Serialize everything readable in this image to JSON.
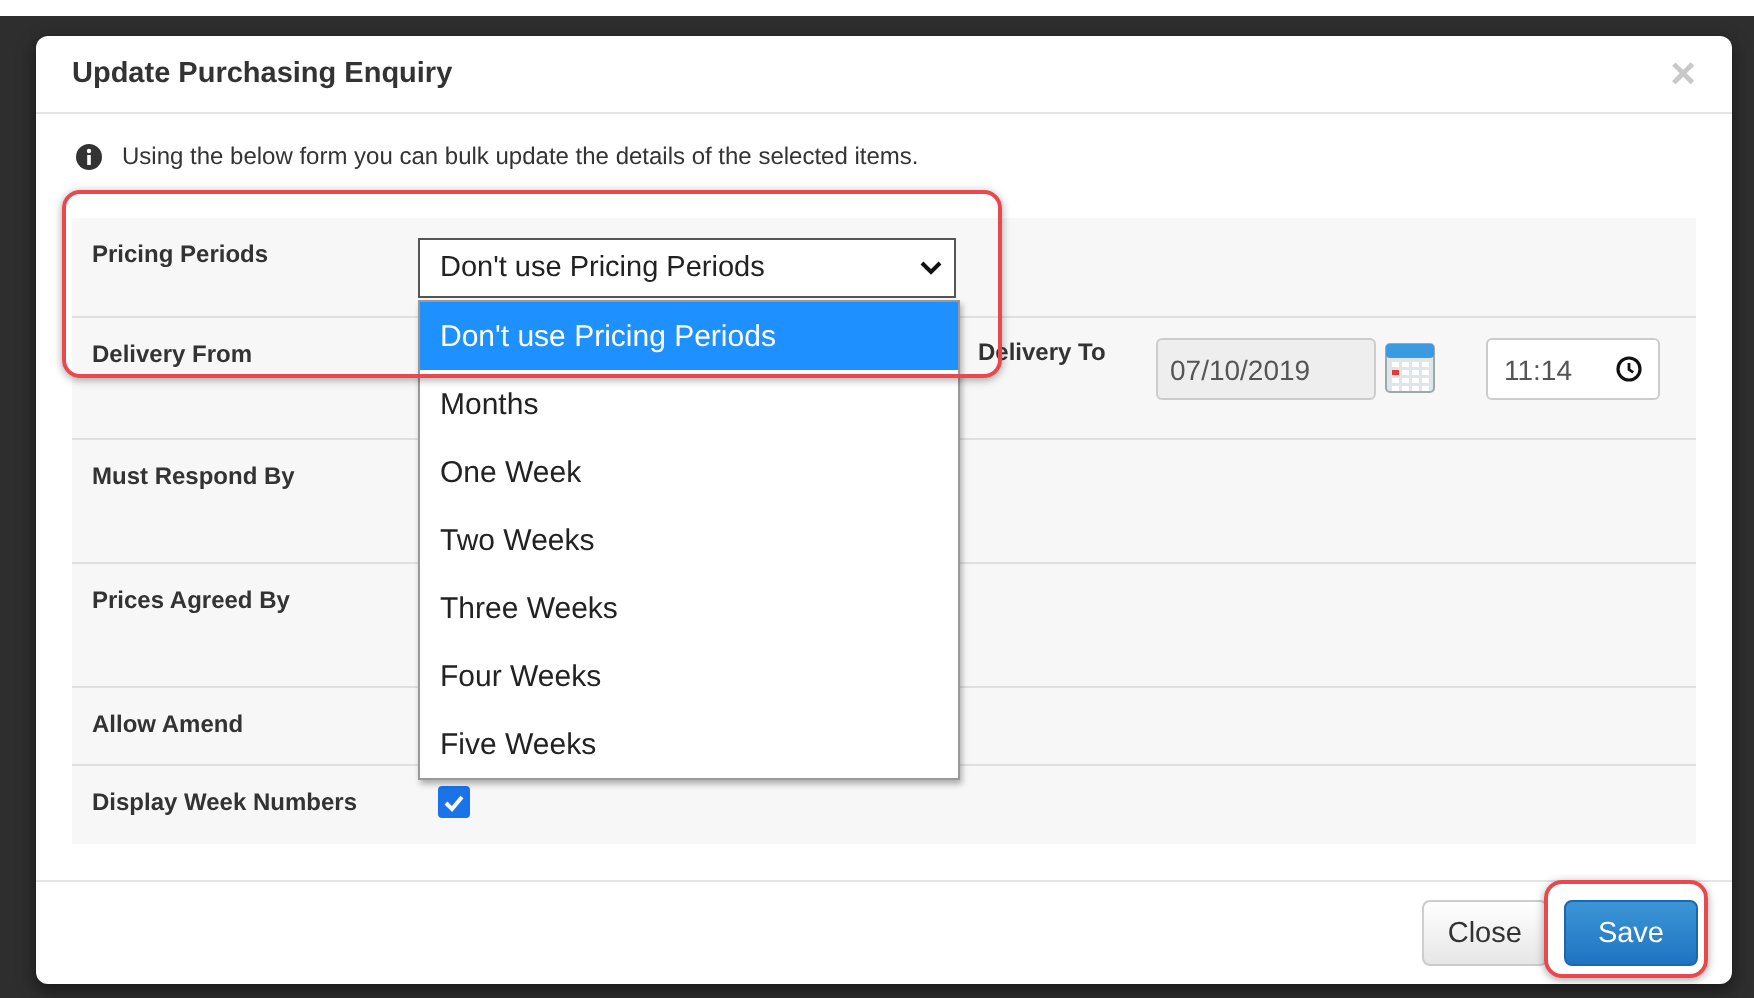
{
  "dialog": {
    "title": "Update Purchasing Enquiry",
    "close_icon": "×",
    "info": "Using the below form you can bulk update the details of the selected items."
  },
  "form": {
    "rows": [
      {
        "kind": "select",
        "label": "Pricing Periods",
        "value": "Don't use Pricing Periods",
        "expanded": true,
        "highlighted": true,
        "options": [
          {
            "label": "Don't use Pricing Periods",
            "selected": true
          },
          {
            "label": "Months",
            "selected": false
          },
          {
            "label": "One Week",
            "selected": false
          },
          {
            "label": "Two Weeks",
            "selected": false
          },
          {
            "label": "Three Weeks",
            "selected": false
          },
          {
            "label": "Four Weeks",
            "selected": false
          },
          {
            "label": "Five Weeks",
            "selected": false
          }
        ]
      },
      {
        "kind": "range",
        "label": "Delivery From",
        "to_label": "Delivery To",
        "to_date": "07/10/2019",
        "to_time": "11:14"
      },
      {
        "kind": "blank",
        "label": "Must Respond By"
      },
      {
        "kind": "blank",
        "label": "Prices Agreed By"
      },
      {
        "kind": "blank",
        "label": "Allow Amend"
      },
      {
        "kind": "checkbox",
        "label": "Display Week Numbers",
        "checked": true
      }
    ]
  },
  "footer": {
    "buttons": [
      {
        "label": "Close",
        "kind": "default",
        "highlighted": false
      },
      {
        "label": "Save",
        "kind": "primary",
        "highlighted": true
      }
    ]
  }
}
